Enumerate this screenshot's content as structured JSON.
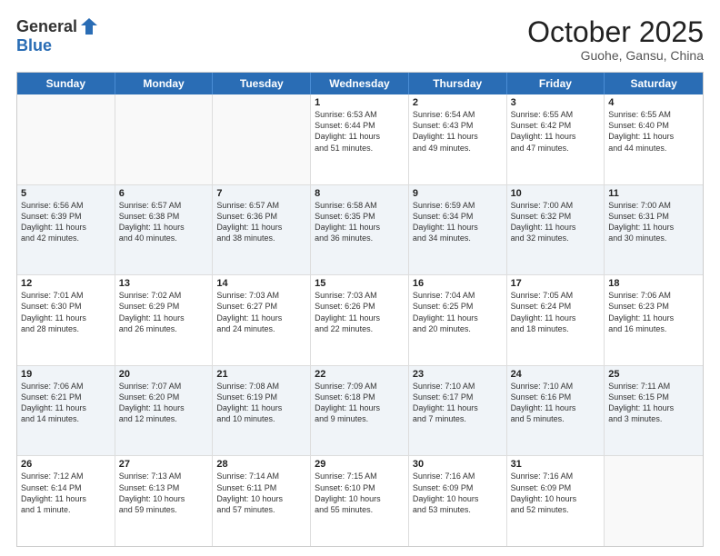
{
  "logo": {
    "general": "General",
    "blue": "Blue"
  },
  "title": "October 2025",
  "location": "Guohe, Gansu, China",
  "header_days": [
    "Sunday",
    "Monday",
    "Tuesday",
    "Wednesday",
    "Thursday",
    "Friday",
    "Saturday"
  ],
  "rows": [
    {
      "alt": false,
      "cells": [
        {
          "day": "",
          "text": ""
        },
        {
          "day": "",
          "text": ""
        },
        {
          "day": "",
          "text": ""
        },
        {
          "day": "1",
          "text": "Sunrise: 6:53 AM\nSunset: 6:44 PM\nDaylight: 11 hours\nand 51 minutes."
        },
        {
          "day": "2",
          "text": "Sunrise: 6:54 AM\nSunset: 6:43 PM\nDaylight: 11 hours\nand 49 minutes."
        },
        {
          "day": "3",
          "text": "Sunrise: 6:55 AM\nSunset: 6:42 PM\nDaylight: 11 hours\nand 47 minutes."
        },
        {
          "day": "4",
          "text": "Sunrise: 6:55 AM\nSunset: 6:40 PM\nDaylight: 11 hours\nand 44 minutes."
        }
      ]
    },
    {
      "alt": true,
      "cells": [
        {
          "day": "5",
          "text": "Sunrise: 6:56 AM\nSunset: 6:39 PM\nDaylight: 11 hours\nand 42 minutes."
        },
        {
          "day": "6",
          "text": "Sunrise: 6:57 AM\nSunset: 6:38 PM\nDaylight: 11 hours\nand 40 minutes."
        },
        {
          "day": "7",
          "text": "Sunrise: 6:57 AM\nSunset: 6:36 PM\nDaylight: 11 hours\nand 38 minutes."
        },
        {
          "day": "8",
          "text": "Sunrise: 6:58 AM\nSunset: 6:35 PM\nDaylight: 11 hours\nand 36 minutes."
        },
        {
          "day": "9",
          "text": "Sunrise: 6:59 AM\nSunset: 6:34 PM\nDaylight: 11 hours\nand 34 minutes."
        },
        {
          "day": "10",
          "text": "Sunrise: 7:00 AM\nSunset: 6:32 PM\nDaylight: 11 hours\nand 32 minutes."
        },
        {
          "day": "11",
          "text": "Sunrise: 7:00 AM\nSunset: 6:31 PM\nDaylight: 11 hours\nand 30 minutes."
        }
      ]
    },
    {
      "alt": false,
      "cells": [
        {
          "day": "12",
          "text": "Sunrise: 7:01 AM\nSunset: 6:30 PM\nDaylight: 11 hours\nand 28 minutes."
        },
        {
          "day": "13",
          "text": "Sunrise: 7:02 AM\nSunset: 6:29 PM\nDaylight: 11 hours\nand 26 minutes."
        },
        {
          "day": "14",
          "text": "Sunrise: 7:03 AM\nSunset: 6:27 PM\nDaylight: 11 hours\nand 24 minutes."
        },
        {
          "day": "15",
          "text": "Sunrise: 7:03 AM\nSunset: 6:26 PM\nDaylight: 11 hours\nand 22 minutes."
        },
        {
          "day": "16",
          "text": "Sunrise: 7:04 AM\nSunset: 6:25 PM\nDaylight: 11 hours\nand 20 minutes."
        },
        {
          "day": "17",
          "text": "Sunrise: 7:05 AM\nSunset: 6:24 PM\nDaylight: 11 hours\nand 18 minutes."
        },
        {
          "day": "18",
          "text": "Sunrise: 7:06 AM\nSunset: 6:23 PM\nDaylight: 11 hours\nand 16 minutes."
        }
      ]
    },
    {
      "alt": true,
      "cells": [
        {
          "day": "19",
          "text": "Sunrise: 7:06 AM\nSunset: 6:21 PM\nDaylight: 11 hours\nand 14 minutes."
        },
        {
          "day": "20",
          "text": "Sunrise: 7:07 AM\nSunset: 6:20 PM\nDaylight: 11 hours\nand 12 minutes."
        },
        {
          "day": "21",
          "text": "Sunrise: 7:08 AM\nSunset: 6:19 PM\nDaylight: 11 hours\nand 10 minutes."
        },
        {
          "day": "22",
          "text": "Sunrise: 7:09 AM\nSunset: 6:18 PM\nDaylight: 11 hours\nand 9 minutes."
        },
        {
          "day": "23",
          "text": "Sunrise: 7:10 AM\nSunset: 6:17 PM\nDaylight: 11 hours\nand 7 minutes."
        },
        {
          "day": "24",
          "text": "Sunrise: 7:10 AM\nSunset: 6:16 PM\nDaylight: 11 hours\nand 5 minutes."
        },
        {
          "day": "25",
          "text": "Sunrise: 7:11 AM\nSunset: 6:15 PM\nDaylight: 11 hours\nand 3 minutes."
        }
      ]
    },
    {
      "alt": false,
      "cells": [
        {
          "day": "26",
          "text": "Sunrise: 7:12 AM\nSunset: 6:14 PM\nDaylight: 11 hours\nand 1 minute."
        },
        {
          "day": "27",
          "text": "Sunrise: 7:13 AM\nSunset: 6:13 PM\nDaylight: 10 hours\nand 59 minutes."
        },
        {
          "day": "28",
          "text": "Sunrise: 7:14 AM\nSunset: 6:11 PM\nDaylight: 10 hours\nand 57 minutes."
        },
        {
          "day": "29",
          "text": "Sunrise: 7:15 AM\nSunset: 6:10 PM\nDaylight: 10 hours\nand 55 minutes."
        },
        {
          "day": "30",
          "text": "Sunrise: 7:16 AM\nSunset: 6:09 PM\nDaylight: 10 hours\nand 53 minutes."
        },
        {
          "day": "31",
          "text": "Sunrise: 7:16 AM\nSunset: 6:09 PM\nDaylight: 10 hours\nand 52 minutes."
        },
        {
          "day": "",
          "text": ""
        }
      ]
    }
  ]
}
